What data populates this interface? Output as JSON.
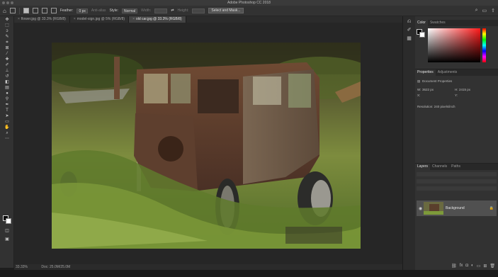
{
  "window": {
    "title": "Adobe Photoshop CC 2018"
  },
  "options_bar": {
    "feather_label": "Feather:",
    "feather_value": "0 px",
    "anti_alias_label": "Anti-alias",
    "style_label": "Style:",
    "style_value": "Normal",
    "width_label": "Width:",
    "height_label": "Height:",
    "select_mask_label": "Select and Mask..."
  },
  "tabs": [
    {
      "label": "flower.jpg @ 33.3% (RGB/8)"
    },
    {
      "label": "model-sign.jpg @ 5% (RGB/8)"
    },
    {
      "label": "old car.jpg @ 33.3% (RGB/8)"
    }
  ],
  "status": {
    "zoom": "33.33%",
    "doc": "Doc: 25.0M/25.0M"
  },
  "color_panel": {
    "tabs": [
      "Color",
      "Swatches"
    ]
  },
  "properties_panel": {
    "tabs": [
      "Properties",
      "Adjustments"
    ],
    "heading": "Document Properties",
    "w_label": "W:",
    "w_value": "3622 px",
    "h_label": "H:",
    "h_value": "2415 px",
    "x_label": "X:",
    "y_label": "Y:",
    "resolution": "Resolution: 240 pixels/inch"
  },
  "layers_panel": {
    "tabs": [
      "Layers",
      "Channels",
      "Paths"
    ],
    "layer_name": "Background"
  },
  "colors": {
    "bg": "#1e1e1e",
    "panel": "#323232",
    "accent": "#e4e4e4"
  }
}
